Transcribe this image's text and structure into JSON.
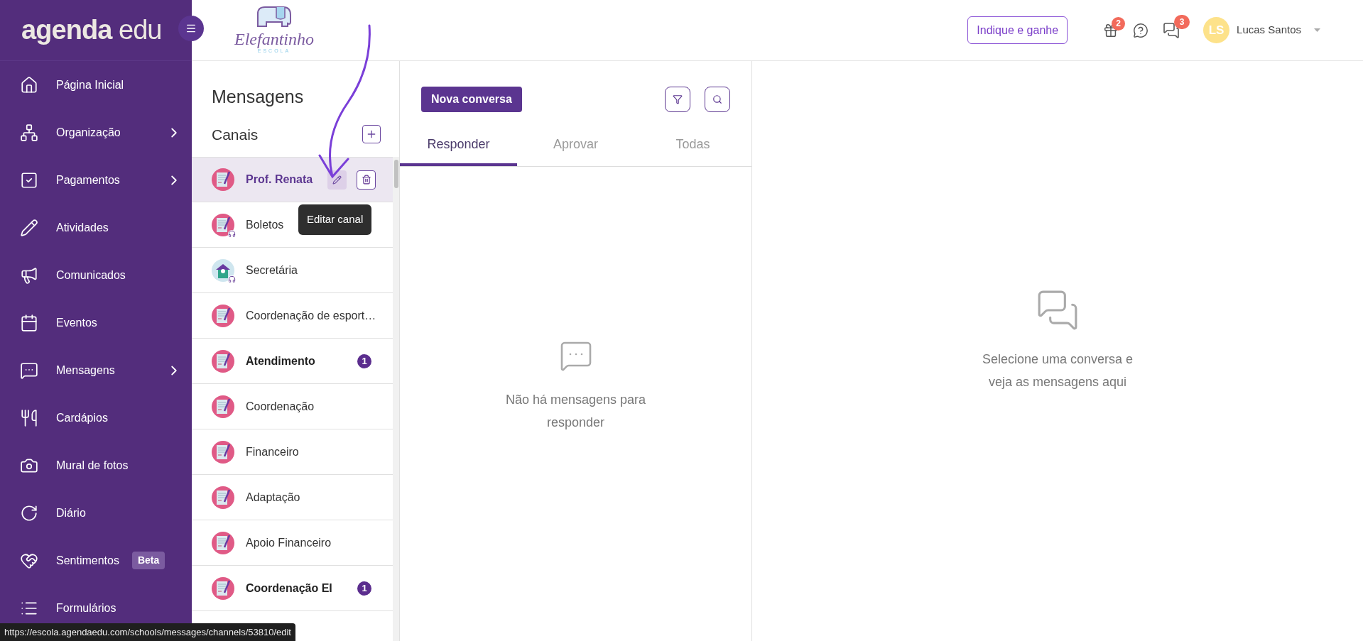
{
  "brand": {
    "name_bold": "agenda",
    "name_light": "edu"
  },
  "school_logo": {
    "name": "Elefantinho",
    "subtitle": "ESCOLA"
  },
  "header": {
    "referral_button": "Indique e ganhe",
    "gift_count": "2",
    "messages_count": "3",
    "user": {
      "initials": "LS",
      "name": "Lucas Santos"
    }
  },
  "sidebar": {
    "items": [
      {
        "label": "Página Inicial",
        "expandable": false
      },
      {
        "label": "Organização",
        "expandable": true
      },
      {
        "label": "Pagamentos",
        "expandable": true
      },
      {
        "label": "Atividades",
        "expandable": false
      },
      {
        "label": "Comunicados",
        "expandable": false
      },
      {
        "label": "Eventos",
        "expandable": false
      },
      {
        "label": "Mensagens",
        "expandable": true
      },
      {
        "label": "Cardápios",
        "expandable": false
      },
      {
        "label": "Mural de fotos",
        "expandable": false
      },
      {
        "label": "Diário",
        "expandable": false
      },
      {
        "label": "Sentimentos",
        "expandable": false,
        "badge": "Beta"
      },
      {
        "label": "Formulários",
        "expandable": false
      }
    ]
  },
  "channels_panel": {
    "title": "Mensagens",
    "subtitle": "Canais",
    "tooltip": "Editar canal",
    "channels": [
      {
        "name": "Prof. Renata",
        "kind": "document",
        "selected": true,
        "support": false
      },
      {
        "name": "Boletos",
        "kind": "document",
        "selected": false,
        "unread": false,
        "support": true
      },
      {
        "name": "Secretária",
        "kind": "school",
        "selected": false,
        "unread": false,
        "support": true
      },
      {
        "name": "Coordenação de esport…",
        "kind": "document",
        "selected": false,
        "unread": false,
        "support": false
      },
      {
        "name": "Atendimento",
        "kind": "document",
        "selected": false,
        "unread": true,
        "count": "1",
        "support": false
      },
      {
        "name": "Coordenação",
        "kind": "document",
        "selected": false,
        "unread": false,
        "support": false
      },
      {
        "name": "Financeiro",
        "kind": "document",
        "selected": false,
        "unread": false,
        "support": false
      },
      {
        "name": "Adaptação",
        "kind": "document",
        "selected": false,
        "unread": false,
        "support": false
      },
      {
        "name": "Apoio Financeiro",
        "kind": "document",
        "selected": false,
        "unread": false,
        "support": false
      },
      {
        "name": "Coordenação EI",
        "kind": "document",
        "selected": false,
        "unread": true,
        "count": "1",
        "support": false
      }
    ]
  },
  "conversations": {
    "new_button": "Nova conversa",
    "tabs": [
      {
        "label": "Responder",
        "selected": true
      },
      {
        "label": "Aprovar",
        "selected": false
      },
      {
        "label": "Todas",
        "selected": false
      }
    ],
    "empty_message": "Não há mensagens para responder"
  },
  "detail": {
    "empty_message": "Selecione uma conversa e veja as mensagens aqui"
  },
  "status_url": "https://escola.agendaedu.com/schools/messages/channels/53810/edit"
}
